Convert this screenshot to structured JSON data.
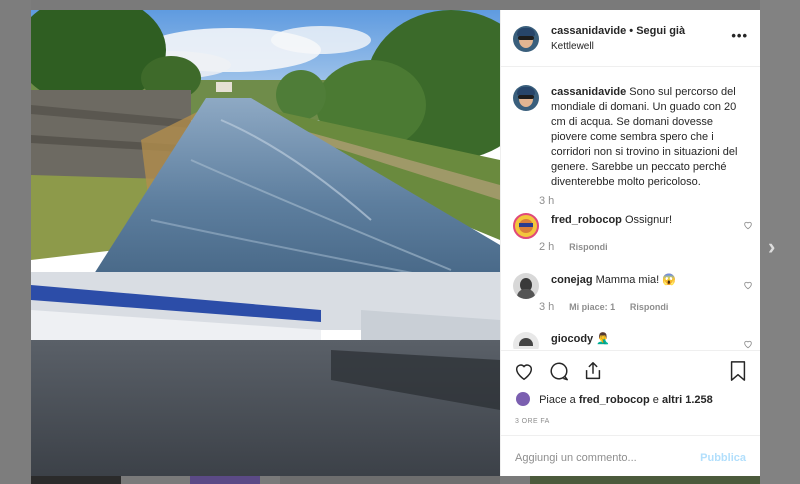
{
  "post": {
    "author": "cassanidavide",
    "separator": "•",
    "follow_label": "Segui già",
    "location": "Kettlewell",
    "more_icon": "more-horizontal-icon"
  },
  "caption": {
    "author": "cassanidavide",
    "text": "Sono sul percorso del mondiale di domani. Un guado con 20 cm di acqua. Se domani dovesse piovere come sembra spero che i corridori non si trovino in situazioni del genere. Sarebbe un peccato perché diventerebbe molto pericoloso.",
    "time": "3 h"
  },
  "comments": [
    {
      "user": "fred_robocop",
      "text": "Ossignur!",
      "time": "2 h",
      "reply": "Rispondi",
      "likes": ""
    },
    {
      "user": "conejag",
      "text": "Mamma mia! 😱",
      "time": "3 h",
      "likes": "Mi piace: 1",
      "reply": "Rispondi"
    },
    {
      "user": "giocody",
      "text": "🤦‍♂️",
      "time": "",
      "likes": "",
      "reply": ""
    }
  ],
  "actions": {
    "like_icon": "heart-icon",
    "comment_icon": "comment-icon",
    "share_icon": "share-icon",
    "save_icon": "bookmark-icon"
  },
  "likes": {
    "prefix": "Piace a",
    "user": "fred_robocop",
    "conj": "e",
    "others": "altri 1.258"
  },
  "posted": "3 ORE FA",
  "composer": {
    "placeholder": "Aggiungi un commento...",
    "publish_label": "Pubblica"
  },
  "navigation": {
    "next_glyph": "›"
  },
  "colors": {
    "link_blue_disabled": "#b2dffc",
    "meta_grey": "#8e8e8e",
    "text": "#262626"
  }
}
